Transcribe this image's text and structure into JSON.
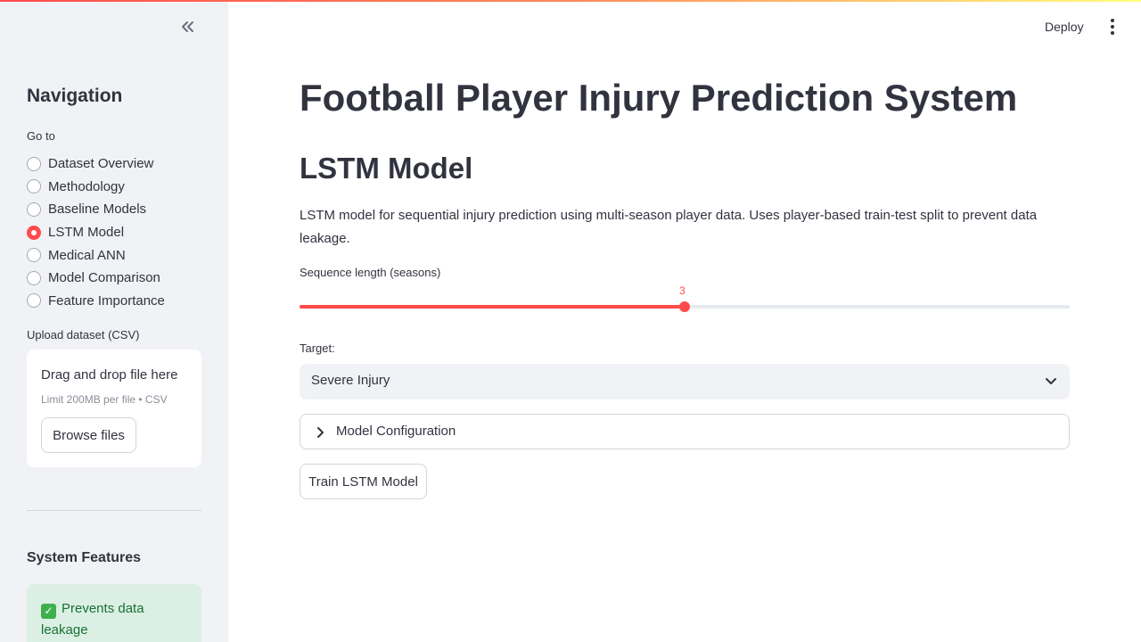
{
  "sidebar": {
    "collapse_icon": "double-chevron-left-icon",
    "nav_title": "Navigation",
    "goto_label": "Go to",
    "nav_items": [
      {
        "label": "Dataset Overview",
        "selected": false
      },
      {
        "label": "Methodology",
        "selected": false
      },
      {
        "label": "Baseline Models",
        "selected": false
      },
      {
        "label": "LSTM Model",
        "selected": true
      },
      {
        "label": "Medical ANN",
        "selected": false
      },
      {
        "label": "Model Comparison",
        "selected": false
      },
      {
        "label": "Feature Importance",
        "selected": false
      }
    ],
    "upload_label": "Upload dataset (CSV)",
    "upload_title": "Drag and drop file here",
    "upload_limit": "Limit 200MB per file • CSV",
    "browse_label": "Browse files",
    "features_title": "System Features",
    "feature_text": "Prevents data leakage"
  },
  "header": {
    "deploy_label": "Deploy",
    "menu_icon": "vertical-dots-icon"
  },
  "main": {
    "title": "Football Player Injury Prediction System",
    "subtitle": "LSTM Model",
    "description": "LSTM model for sequential injury prediction using multi-season player data. Uses player-based train-test split to prevent data leakage.",
    "slider": {
      "label": "Sequence length (seasons)",
      "value": "3",
      "fraction": 0.5
    },
    "target": {
      "label": "Target:",
      "value": "Severe Injury"
    },
    "expander_label": "Model Configuration",
    "train_button": "Train LSTM Model"
  },
  "colors": {
    "accent": "#ff4b4b",
    "sidebar_bg": "#f0f2f6",
    "success_bg": "#dcefe4",
    "success_text": "#177233"
  }
}
